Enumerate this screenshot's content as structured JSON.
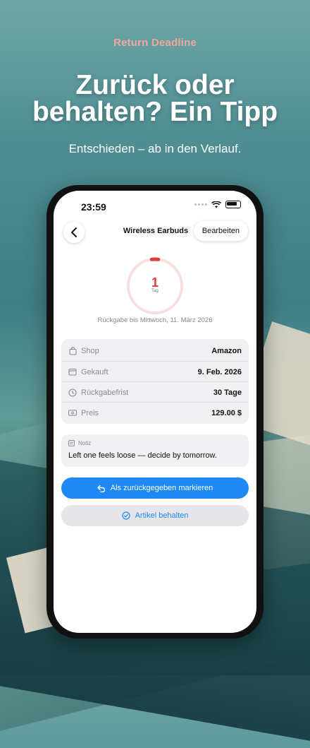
{
  "marketing": {
    "eyebrow": "Return Deadline",
    "headline_line1": "Zurück oder",
    "headline_line2": "behalten? Ein Tipp",
    "subline": "Entschieden – ab in den Verlauf."
  },
  "status_bar": {
    "time": "23:59"
  },
  "nav": {
    "title": "Wireless Earbuds",
    "edit_label": "Bearbeiten"
  },
  "countdown": {
    "days": "1",
    "unit": "Tag",
    "progress_fraction": 0.04,
    "deadline_text": "Rückgabe bis Mittwoch, 11. März 2026",
    "accent": "#e53935"
  },
  "details": [
    {
      "icon": "bag-icon",
      "label": "Shop",
      "value": "Amazon"
    },
    {
      "icon": "calendar-icon",
      "label": "Gekauft",
      "value": "9. Feb. 2026"
    },
    {
      "icon": "clock-icon",
      "label": "Rückgabefrist",
      "value": "30 Tage"
    },
    {
      "icon": "banknote-icon",
      "label": "Preis",
      "value": "129.00 $"
    }
  ],
  "note": {
    "label": "Notiz",
    "text": "Left one feels loose — decide by tomorrow."
  },
  "actions": {
    "primary_label": "Als zurückgegeben markieren",
    "secondary_label": "Artikel behalten",
    "primary_color": "#1e88f5"
  }
}
